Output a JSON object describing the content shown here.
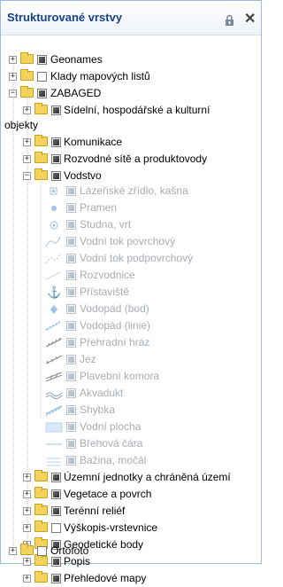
{
  "header": {
    "title": "Strukturované vrstvy",
    "lock_icon": "lock-icon",
    "close_icon": "close-icon"
  },
  "tree": {
    "geonames": "Geonames",
    "klady": "Klady mapových listů",
    "zabaged": "ZABAGED",
    "sidelni": "Sídelní, hospodářské a kulturní",
    "sidelni_wrap": "objekty",
    "komunikace": "Komunikace",
    "rozvodne": "Rozvodné sítě a produktovody",
    "vodstvo": "Vodstvo",
    "vodstvo_items": [
      {
        "label": "Lázeňské zřídlo, kašna",
        "icon": "spa-fountain-icon"
      },
      {
        "label": "Pramen",
        "icon": "spring-icon"
      },
      {
        "label": "Studna, vrt",
        "icon": "well-icon"
      },
      {
        "label": "Vodní tok povrchový",
        "icon": "surface-stream-icon"
      },
      {
        "label": "Vodní tok podpovrchový",
        "icon": "underground-stream-icon"
      },
      {
        "label": "Rozvodnice",
        "icon": "watershed-icon"
      },
      {
        "label": "Přístaviště",
        "icon": "anchor-icon"
      },
      {
        "label": "Vodopád (bod)",
        "icon": "waterfall-point-icon"
      },
      {
        "label": "Vodopád (linie)",
        "icon": "waterfall-line-icon"
      },
      {
        "label": "Přehradní hráz",
        "icon": "dam-icon"
      },
      {
        "label": "Jez",
        "icon": "weir-icon"
      },
      {
        "label": "Plavební komora",
        "icon": "lock-chamber-icon"
      },
      {
        "label": "Akvadukt",
        "icon": "aqueduct-icon"
      },
      {
        "label": "Shybka",
        "icon": "siphon-icon"
      },
      {
        "label": "Vodní plocha",
        "icon": "water-area-icon"
      },
      {
        "label": "Břehová čára",
        "icon": "shoreline-icon"
      },
      {
        "label": "Bažina, močál",
        "icon": "swamp-icon"
      }
    ],
    "uzemni": "Územní jednotky a chráněná území",
    "vegetace": "Vegetace a povrch",
    "terenni": "Terénní reliéf",
    "vyskopis": "Výškopis-vrstevnice",
    "geodeticke": "Geodetické body",
    "popis": "Popis",
    "prehledove": "Přehledové mapy",
    "ortofoto": "Ortofoto"
  },
  "colors": {
    "title": "#15428b",
    "disabled_text": "#a7adb3",
    "folder": "#f3d35b",
    "border": "#99bbe8"
  }
}
